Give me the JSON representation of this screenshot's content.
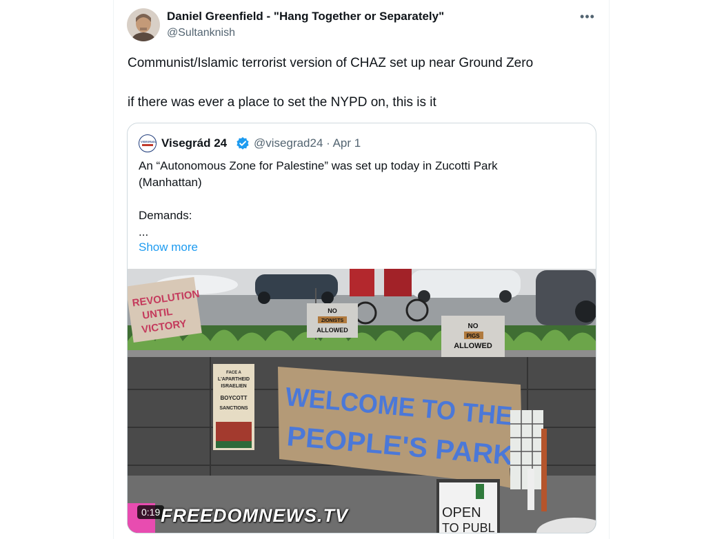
{
  "tweet": {
    "display_name": "Daniel Greenfield - \"Hang Together or Separately\"",
    "handle": "@Sultanknish",
    "more_icon": "more-horizontal-icon",
    "text_line1": "Communist/Islamic terrorist version of CHAZ set up near Ground Zero",
    "text_line2": "if there was ever a place to set the NYPD on, this is it"
  },
  "quote": {
    "name": "Visegrád 24",
    "logo_text": "VISEGRAD24",
    "verified_icon": "verified-badge-icon",
    "verified_color": "#1d9bf0",
    "handle_date": "@visegrad24 · Apr 1",
    "line1": "An “Autonomous Zone for Palestine” was set up today in Zucotti Park",
    "line2": "(Manhattan)",
    "line3": "Demands:",
    "line4": "...",
    "show_more": "Show more"
  },
  "media": {
    "duration": "0:19",
    "watermark": "FREEDOMNEWS.TV",
    "sign_revolution": [
      "REVOLUTION",
      "UNTIL",
      "VICTORY"
    ],
    "sign_zionists": [
      "NO",
      "ZIONISTS",
      "ALLOWED"
    ],
    "sign_pigs": [
      "NO",
      "PIGS",
      "ALLOWED"
    ],
    "banner_line1": "WELCOME TO THE",
    "banner_line2": "PEOPLE'S PARK",
    "poster_lines": [
      "FACE A",
      "L'APARTHEID",
      "ISRAELIEN",
      "BOYCOTT",
      "SANCTIONS"
    ],
    "open_sign": [
      "OPEN",
      "TO PUBL"
    ]
  },
  "colors": {
    "link": "#1d9bf0",
    "secondary_text": "#536471",
    "border": "#cfd9de"
  }
}
